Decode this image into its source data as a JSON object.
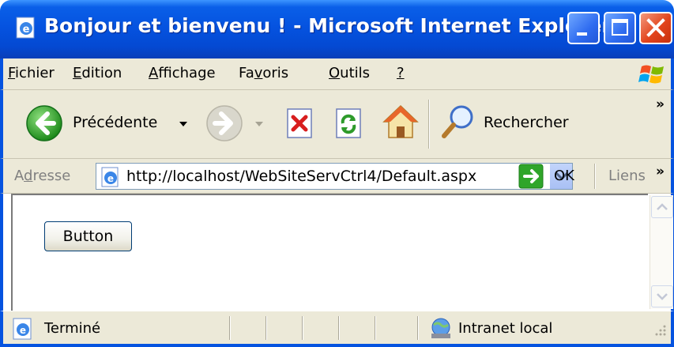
{
  "window": {
    "title": "Bonjour et bienvenu ! - Microsoft Internet Explorer",
    "minimize_icon": "minimize-icon",
    "maximize_icon": "maximize-icon",
    "close_icon": "close-icon"
  },
  "menu": {
    "items": [
      {
        "label": "Fichier",
        "accel": "F",
        "rest": "ichier"
      },
      {
        "label": "Edition",
        "accel": "E",
        "rest": "dition"
      },
      {
        "label": "Affichage",
        "accel": "A",
        "rest": "ffichage"
      },
      {
        "pre": "Fa",
        "accel": "v",
        "rest": "oris"
      },
      {
        "label": "Outils",
        "accel": "O",
        "rest": "utils"
      },
      {
        "label": "?",
        "accel": "?",
        "rest": ""
      }
    ]
  },
  "toolbar": {
    "back_label": "Précédente",
    "search_label": "Rechercher"
  },
  "address": {
    "label_accel": "d",
    "label_pre": "A",
    "label_rest": "resse",
    "url": "http://localhost/WebSiteServCtrl4/Default.aspx",
    "go_label": "OK",
    "links_label": "Liens"
  },
  "page": {
    "button_label": "Button"
  },
  "status": {
    "text": "Terminé",
    "zone": "Intranet local"
  },
  "colors": {
    "titlebar": "#0553e0",
    "chrome": "#ece9d8",
    "back_green": "#2fa52a",
    "close_red": "#e2441c"
  }
}
